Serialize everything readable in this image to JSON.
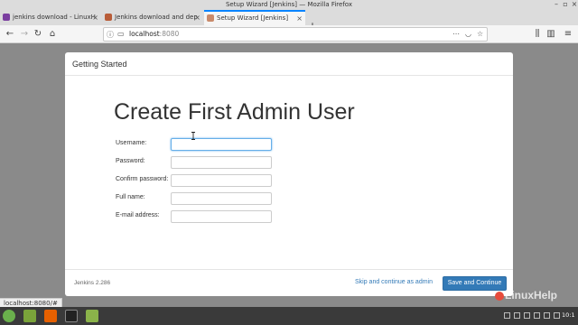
{
  "window": {
    "title": "Setup Wizard [Jenkins] — Mozilla Firefox"
  },
  "tabs": [
    {
      "label": "jenkins download - LinuxH",
      "favicon_color": "#7b3fa0"
    },
    {
      "label": "Jenkins download and dep",
      "favicon_color": "#b85c38"
    },
    {
      "label": "Setup Wizard [Jenkins]",
      "favicon_color": "#c98a6b",
      "active": true
    }
  ],
  "navbar": {
    "url_host": "localhost",
    "url_port": ":8080"
  },
  "modal": {
    "header": "Getting Started",
    "heading": "Create First Admin User",
    "fields": [
      {
        "label": "Username:",
        "value": ""
      },
      {
        "label": "Password:",
        "value": ""
      },
      {
        "label": "Confirm password:",
        "value": ""
      },
      {
        "label": "Full name:",
        "value": ""
      },
      {
        "label": "E-mail address:",
        "value": ""
      }
    ],
    "footer": {
      "version": "Jenkins 2.286",
      "skip_label": "Skip and continue as admin",
      "save_label": "Save and Continue"
    }
  },
  "status_url": "localhost:8080/#",
  "watermark": "LinuxHelp",
  "clock": "10:1",
  "colors": {
    "accent": "#337ab7",
    "tab_highlight": "#0a84ff",
    "backdrop": "#8a8a8a"
  }
}
